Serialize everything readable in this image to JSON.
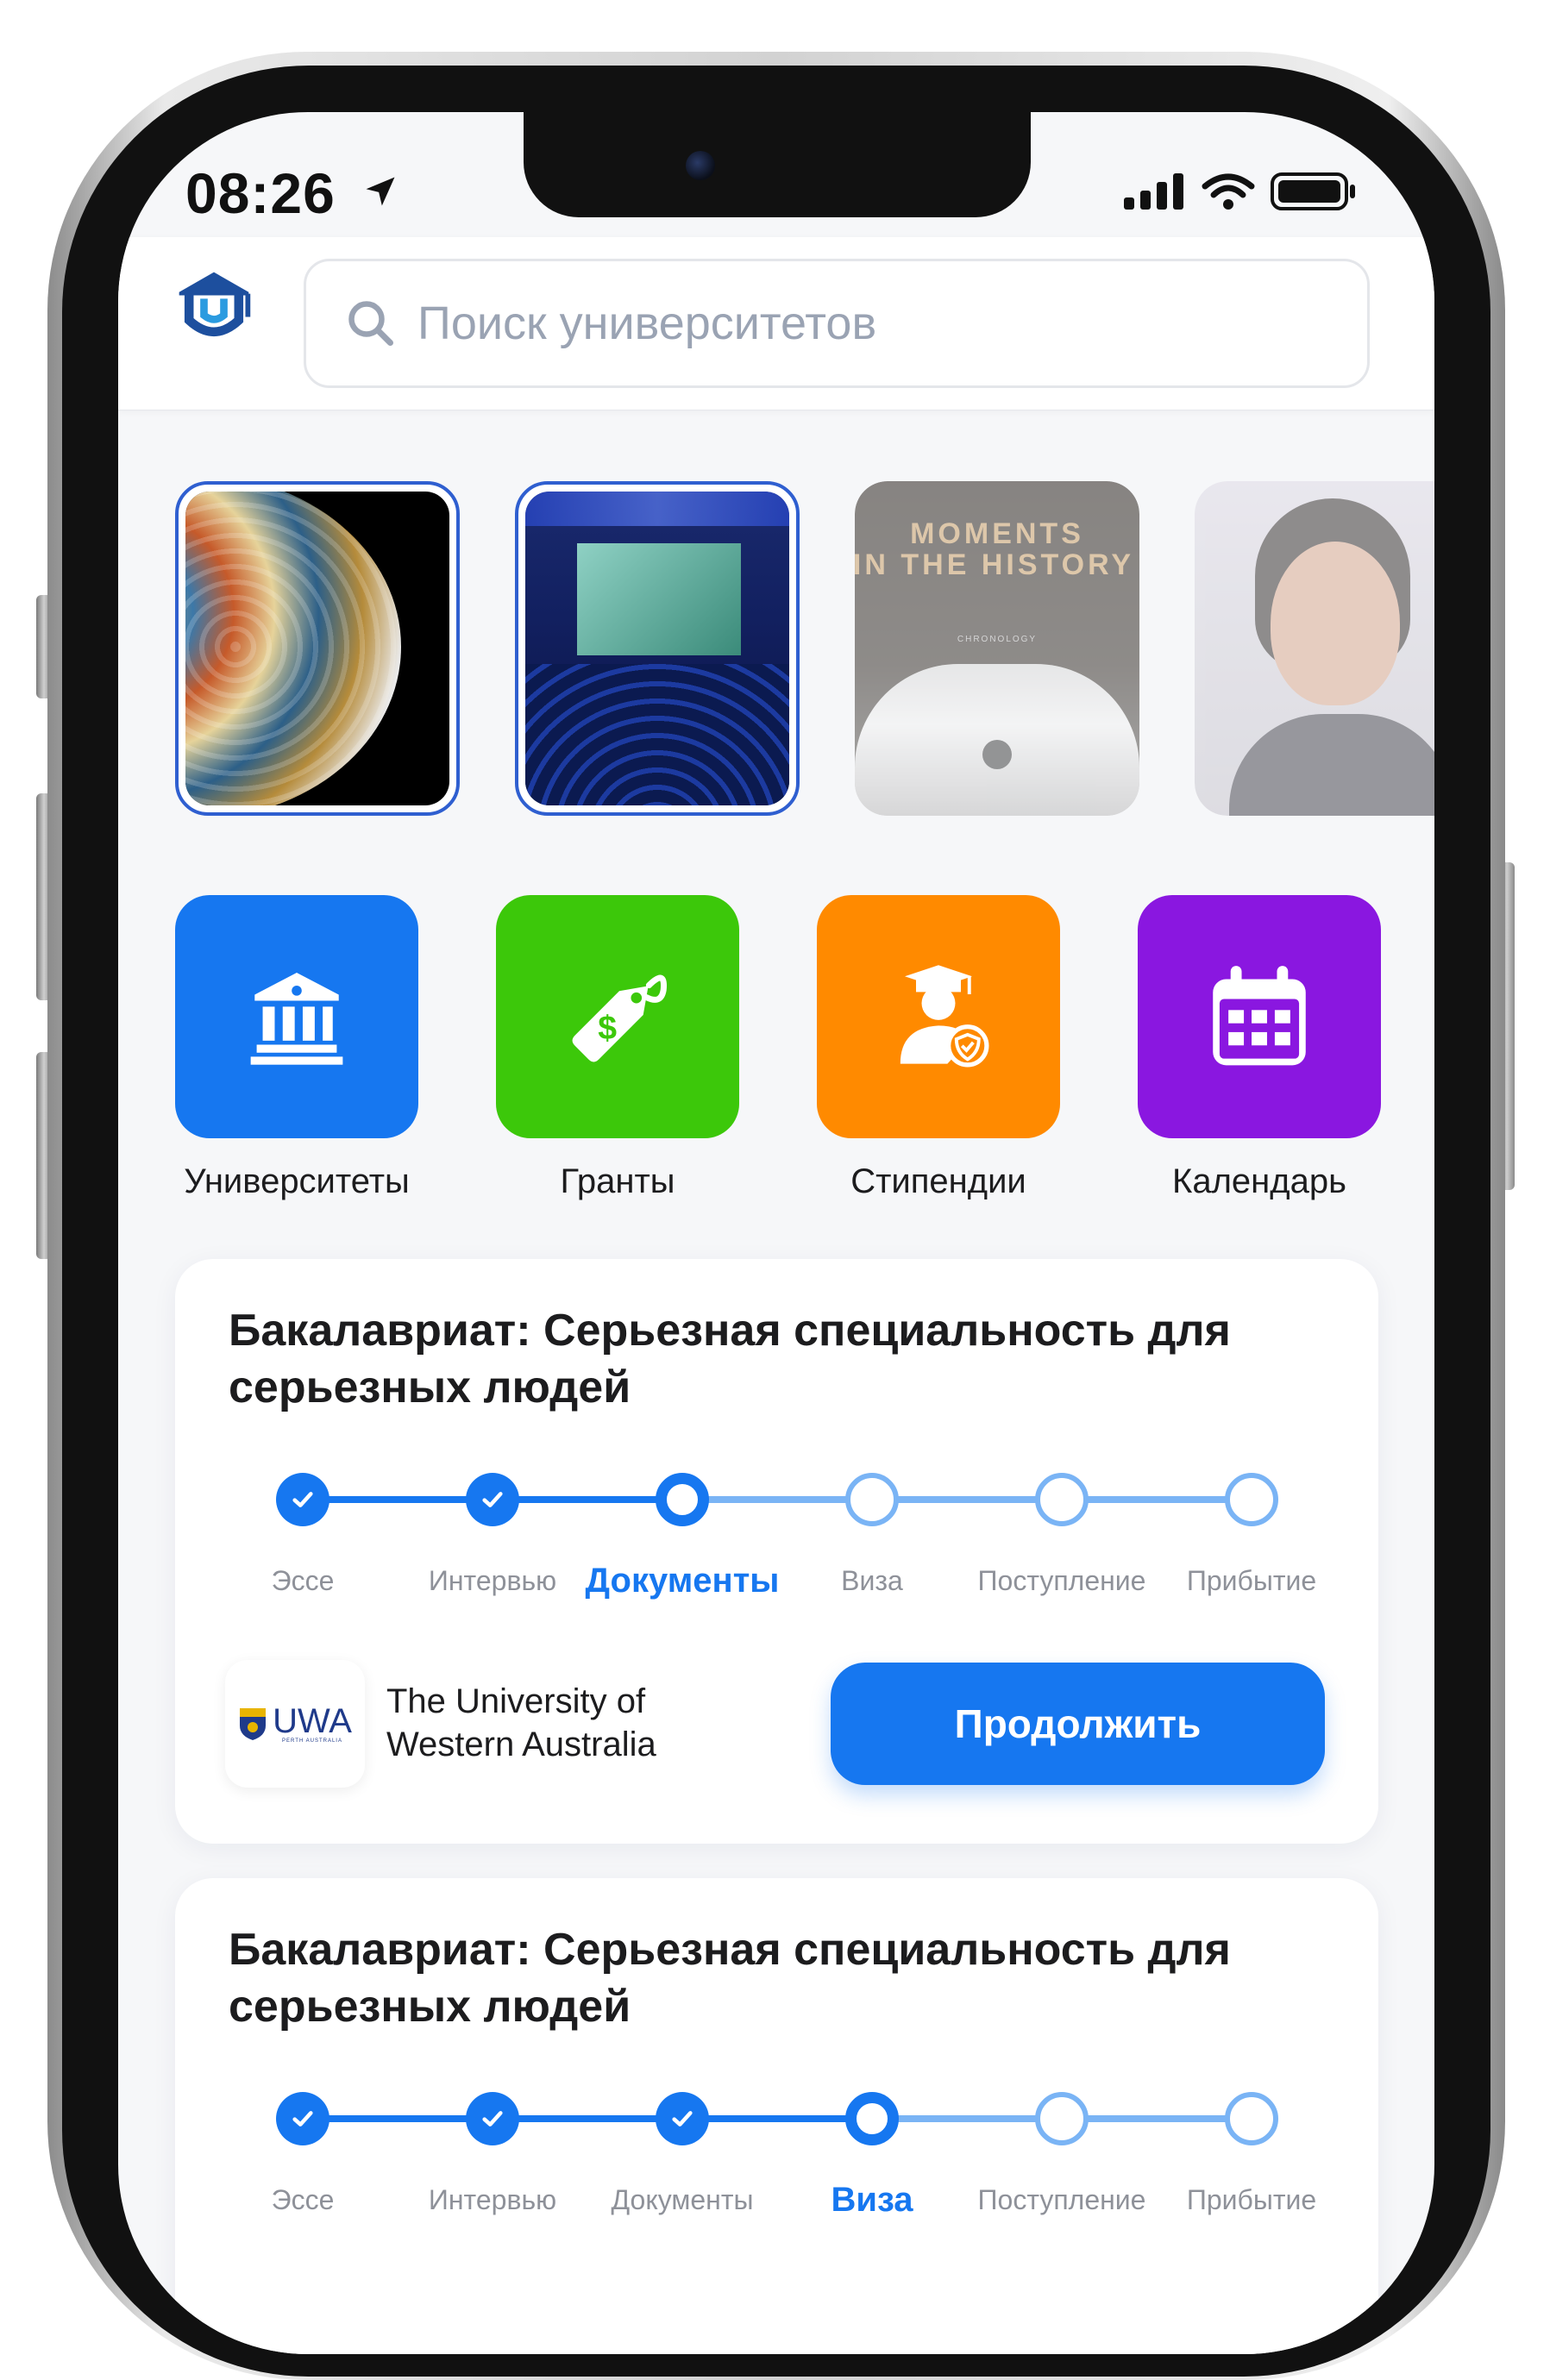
{
  "status_bar": {
    "time": "08:26"
  },
  "search": {
    "placeholder": "Поиск университетов"
  },
  "stories": [
    {
      "name": "planet",
      "state": "active"
    },
    {
      "name": "conference",
      "state": "active"
    },
    {
      "name": "moments",
      "state": "seen",
      "line1": "MOMENTS",
      "line2": "IN THE HISTORY",
      "tag": "CHRONOLOGY"
    },
    {
      "name": "portrait",
      "state": "seen"
    }
  ],
  "categories": [
    {
      "label": "Университеты",
      "icon": "bank-icon",
      "color": "#1677f0"
    },
    {
      "label": "Гранты",
      "icon": "dollar-tag-icon",
      "color": "#3cc80a"
    },
    {
      "label": "Стипендии",
      "icon": "graduate-shield-icon",
      "color": "#ff8a00"
    },
    {
      "label": "Календарь",
      "icon": "calendar-icon",
      "color": "#8a17e0"
    }
  ],
  "cards": [
    {
      "title": "Бакалавриат: Серьезная специальность для серьезных людей",
      "steps": [
        "Эссе",
        "Интервью",
        "Документы",
        "Виза",
        "Поступление",
        "Прибытие"
      ],
      "current_step": 2,
      "university_logo_text": "UWA",
      "university_logo_subtext": "PERTH AUSTRALIA",
      "university": "The University of Western Australia",
      "button": "Продолжить"
    },
    {
      "title": "Бакалавриат: Серьезная специальность для серьезных людей",
      "steps": [
        "Эссе",
        "Интервью",
        "Документы",
        "Виза",
        "Поступление",
        "Прибытие"
      ],
      "current_step": 3
    }
  ],
  "colors": {
    "accent": "#1677f0",
    "accent_light": "#7ab4f5",
    "background": "#f6f7f9"
  }
}
